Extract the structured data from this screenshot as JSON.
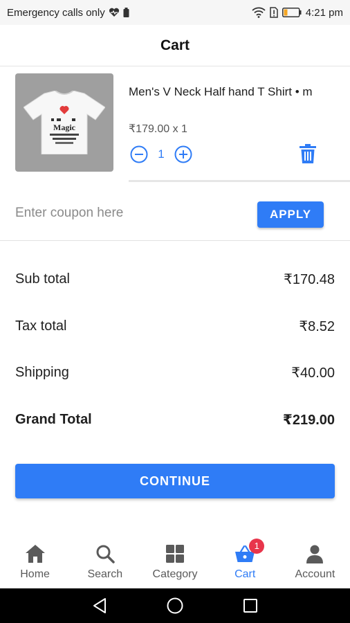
{
  "status_bar": {
    "carrier_text": "Emergency calls only",
    "time": "4:21 pm"
  },
  "header": {
    "title": "Cart"
  },
  "cart_item": {
    "name": "Men's V Neck Half hand T Shirt • m",
    "price_line": "₹179.00 x 1",
    "quantity": "1",
    "thumb_print_text": "Magic"
  },
  "coupon": {
    "placeholder": "Enter coupon here",
    "value": "",
    "apply_label": "APPLY"
  },
  "summary": {
    "subtotal_label": "Sub total",
    "subtotal_value": "₹170.48",
    "tax_label": "Tax total",
    "tax_value": "₹8.52",
    "shipping_label": "Shipping",
    "shipping_value": "₹40.00",
    "grand_label": "Grand Total",
    "grand_value": "₹219.00"
  },
  "continue_label": "CONTINUE",
  "bottom_nav": {
    "items": [
      {
        "label": "Home",
        "icon": "home-icon"
      },
      {
        "label": "Search",
        "icon": "search-icon"
      },
      {
        "label": "Category",
        "icon": "category-grid-icon"
      },
      {
        "label": "Cart",
        "icon": "cart-basket-icon",
        "badge": "1",
        "active": true
      },
      {
        "label": "Account",
        "icon": "account-icon"
      }
    ]
  },
  "colors": {
    "accent": "#2f7cf6",
    "badge": "#e8354b",
    "thumb_bg": "#9f9f9f"
  }
}
